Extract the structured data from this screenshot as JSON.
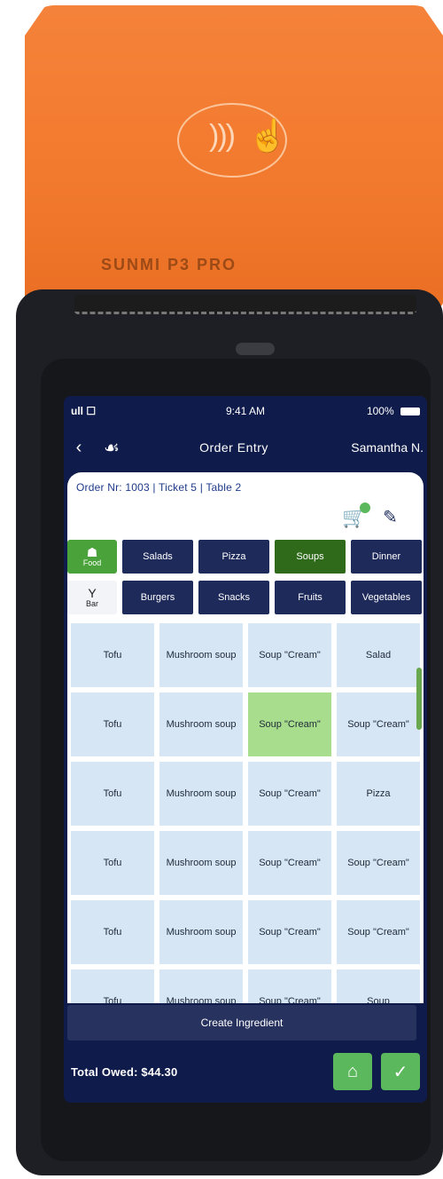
{
  "device": {
    "brand_label": "SUNMI P3 PRO"
  },
  "status": {
    "signal": "ull ☐",
    "time": "9:41 AM",
    "battery": "100%"
  },
  "nav": {
    "title": "Order Entry",
    "user": "Samantha N."
  },
  "order_info": "Order Nr: 1003 | Ticket 5 | Table 2",
  "categories_side": [
    {
      "label": "Food",
      "icon": "food-icon"
    },
    {
      "label": "Bar",
      "icon": "bar-icon"
    }
  ],
  "category_row1": [
    "Salads",
    "Pizza",
    "Soups",
    "Dinner"
  ],
  "category_row2": [
    "Burgers",
    "Snacks",
    "Fruits",
    "Vegetables"
  ],
  "category_active": "Soups",
  "grid_items": [
    [
      "Tofu",
      "Mushroom soup",
      "Soup \"Cream\"",
      "Salad"
    ],
    [
      "Tofu",
      "Mushroom soup",
      "Soup \"Cream\"",
      "Soup \"Cream\""
    ],
    [
      "Tofu",
      "Mushroom soup",
      "Soup \"Cream\"",
      "Pizza"
    ],
    [
      "Tofu",
      "Mushroom soup",
      "Soup \"Cream\"",
      "Soup \"Cream\""
    ],
    [
      "Tofu",
      "Mushroom soup",
      "Soup \"Cream\"",
      "Soup \"Cream\""
    ],
    [
      "Tofu",
      "Mushroom soup",
      "Soup \"Cream\"",
      "Soup"
    ]
  ],
  "active_cell": "row2-col3",
  "bottom_action": "Create Ingredient",
  "footer": {
    "total": "Total Owed: $44.30"
  },
  "colors": {
    "accent_orange": "#f27a2e",
    "navy": "#0f1b4a",
    "green": "#5cb85c",
    "cell": "#d6e6f5"
  }
}
